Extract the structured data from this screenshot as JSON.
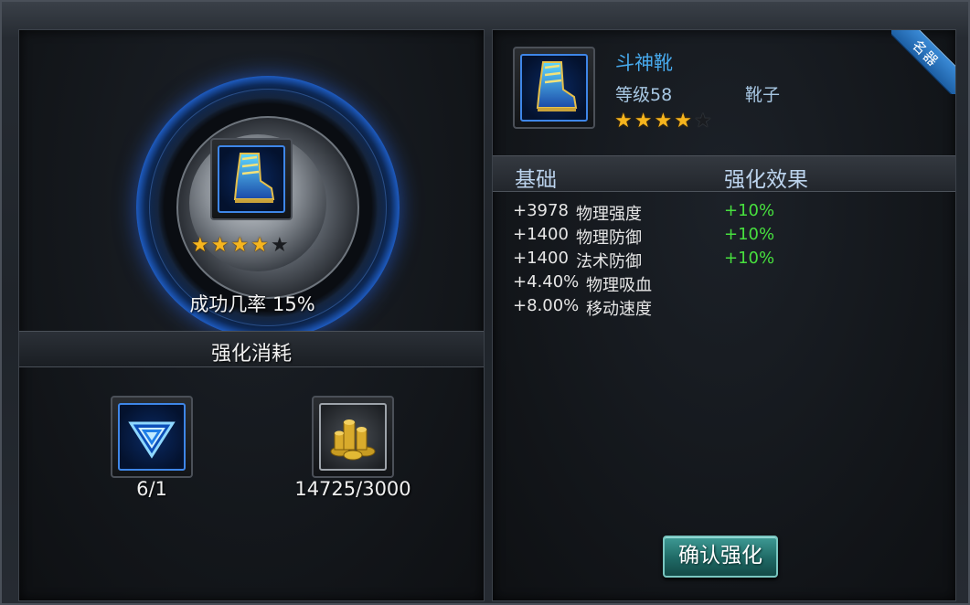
{
  "left_panel": {
    "success_text": "成功几率 15%",
    "stars": {
      "filled": 4,
      "total": 5
    },
    "cost_header": "强化消耗",
    "costs": [
      {
        "icon": "crystal-triangle-icon",
        "label": "6/1"
      },
      {
        "icon": "gold-coins-icon",
        "label": "14725/3000"
      }
    ]
  },
  "right_panel": {
    "badge": "名器",
    "item": {
      "name": "斗神靴",
      "level": "等级58",
      "type": "靴子",
      "icon": "boot-icon",
      "stars": {
        "filled": 4,
        "total": 5
      }
    },
    "table_headers": {
      "base": "基础",
      "effect": "强化效果"
    },
    "stats": [
      {
        "value": "+3978",
        "name": "物理强度",
        "bonus": "+10%"
      },
      {
        "value": "+1400",
        "name": "物理防御",
        "bonus": "+10%"
      },
      {
        "value": "+1400",
        "name": "法术防御",
        "bonus": "+10%"
      },
      {
        "value": "+4.40%",
        "name": "物理吸血",
        "bonus": ""
      },
      {
        "value": "+8.00%",
        "name": "移动速度",
        "bonus": ""
      }
    ],
    "confirm_label": "确认强化"
  },
  "colors": {
    "accent_blue": "#47a9ec",
    "bonus_green": "#47e03e",
    "star_gold": "#f6b51e",
    "button_teal": "#1f6965"
  }
}
